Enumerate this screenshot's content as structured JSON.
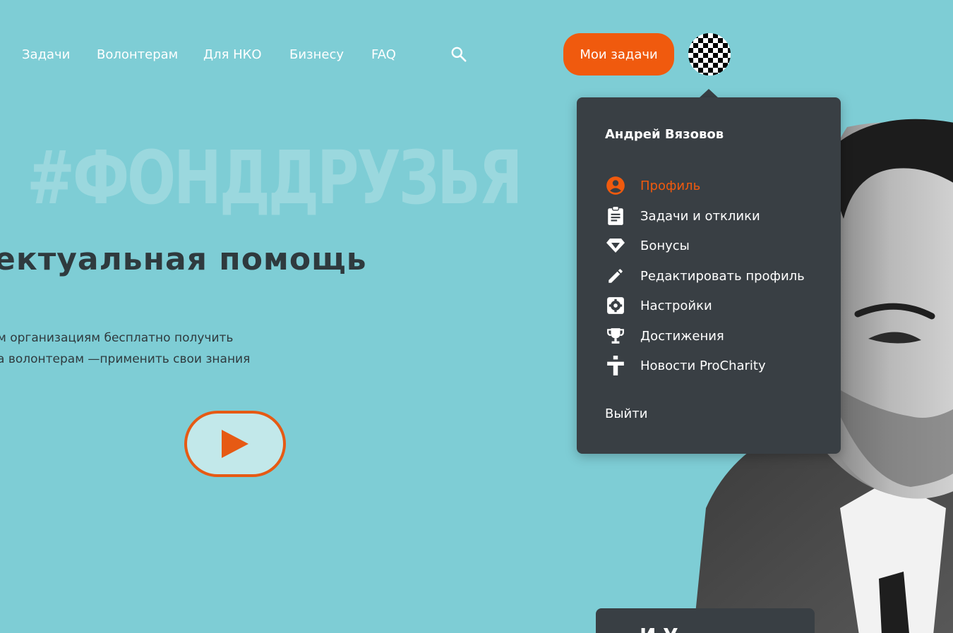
{
  "nav": {
    "items": [
      {
        "label": "Задачи"
      },
      {
        "label": "Волонтерам"
      },
      {
        "label": "Для НКО"
      },
      {
        "label": "Бизнесу"
      },
      {
        "label": "FAQ"
      }
    ],
    "search_icon": "search-icon",
    "my_tasks_label": "Мои задачи",
    "avatar_icon": "avatar-checkerboard"
  },
  "hero": {
    "hashtag": "#ФОНДДРУЗЬЯ",
    "title": "ектуальная помощь",
    "text_line_1": "м организациям бесплатно получить",
    "text_line_2": "а волонтерам —применить свои знания",
    "play_icon": "play-icon"
  },
  "dropdown": {
    "user_name": "Андрей Вязовов",
    "items": [
      {
        "label": "Профиль",
        "icon": "account-circle-icon",
        "active": true
      },
      {
        "label": "Задачи и отклики",
        "icon": "clipboard-icon",
        "active": false
      },
      {
        "label": "Бонусы",
        "icon": "diamond-icon",
        "active": false
      },
      {
        "label": "Редактировать профиль",
        "icon": "pencil-icon",
        "active": false
      },
      {
        "label": "Настройки",
        "icon": "settings-icon",
        "active": false
      },
      {
        "label": "Достижения",
        "icon": "trophy-icon",
        "active": false
      },
      {
        "label": "Новости ProCharity",
        "icon": "procharity-logo-icon",
        "active": false
      }
    ],
    "logout_label": "Выйти"
  },
  "bottom_card": {
    "text": "И У"
  },
  "colors": {
    "background": "#7ecdd5",
    "accent": "#f05a0e",
    "dropdown_bg": "#393f44",
    "text_dark": "#2f3a3e"
  }
}
